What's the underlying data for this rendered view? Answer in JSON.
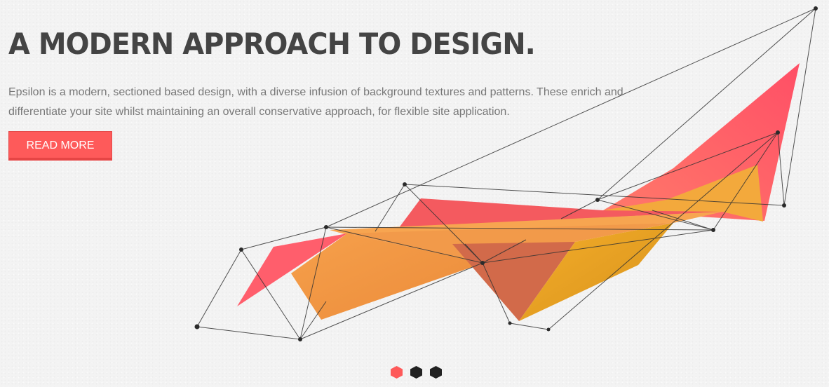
{
  "hero": {
    "title": "A MODERN APPROACH TO DESIGN.",
    "description": "Epsilon is a modern, sectioned based design, with a diverse infusion of background textures and patterns. These enrich and differentiate your site whilst maintaining an overall conservative approach, for flexible site application.",
    "button_label": "READ MORE"
  },
  "slider": {
    "slide_count": 3,
    "active_index": 0,
    "dots": [
      {
        "state": "active"
      },
      {
        "state": "inactive"
      },
      {
        "state": "inactive"
      }
    ]
  },
  "colors": {
    "heading": "#444444",
    "body_text": "#777777",
    "accent": "#fe5a5a",
    "dot_inactive": "#222222",
    "art_red": "#ff5d66",
    "art_orange": "#f5a63d",
    "art_gold": "#e7a21f",
    "art_line": "#333333"
  }
}
